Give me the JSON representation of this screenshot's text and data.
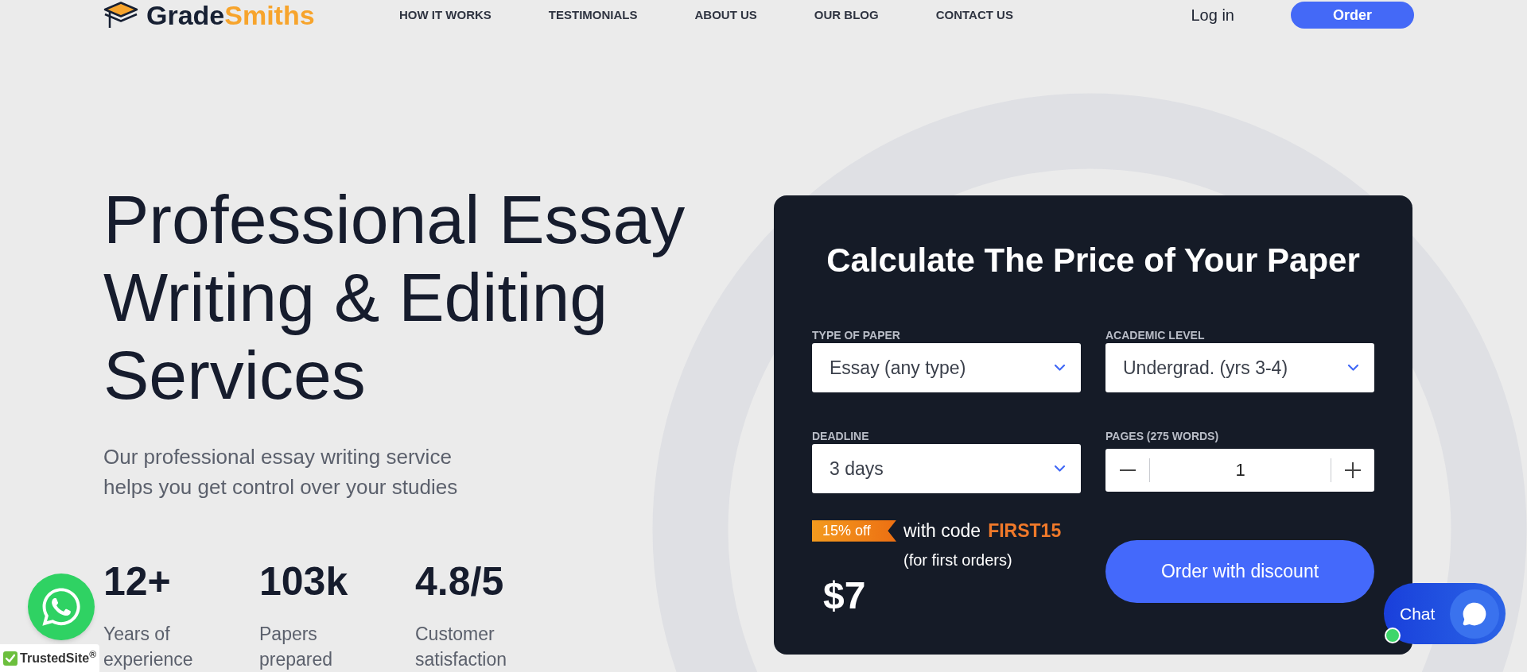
{
  "logo": {
    "word_parts": [
      "Grade",
      "Smiths"
    ]
  },
  "nav": {
    "links": [
      "HOW IT WORKS",
      "TESTIMONIALS",
      "ABOUT US",
      "OUR BLOG",
      "CONTACT US"
    ],
    "login": "Log in",
    "order_button": "Order"
  },
  "hero": {
    "heading_lines": [
      "Professional Essay",
      "Writing & Editing",
      "Services"
    ],
    "subtitle_lines": [
      "Our professional essay writing service",
      "helps you get control over your studies"
    ],
    "stats": [
      {
        "value": "12+",
        "label_lines": [
          "Years of",
          "experience"
        ]
      },
      {
        "value": "103k",
        "label_lines": [
          "Papers",
          "prepared"
        ]
      },
      {
        "value": "4.8/5",
        "label_lines": [
          "Customer",
          "satisfaction"
        ]
      }
    ]
  },
  "calculator": {
    "title": "Calculate The Price of Your Paper",
    "fields": [
      {
        "kind": "select",
        "label": "TYPE OF PAPER",
        "value": "Essay (any type)"
      },
      {
        "kind": "select",
        "label": "ACADEMIC LEVEL",
        "value": "Undergrad. (yrs 3-4)"
      },
      {
        "kind": "select",
        "label": "DEADLINE",
        "value": "3 days"
      },
      {
        "kind": "stepper",
        "label": "PAGES (275 WORDS)",
        "value": "1"
      }
    ],
    "promo": {
      "badge": "15% off",
      "text": "with code",
      "code": "FIRST15",
      "note": "(for first orders)"
    },
    "price": "$7",
    "order_button": "Order with discount"
  },
  "chat_widget": {
    "label": "Chat",
    "online": true
  },
  "trust_badge": {
    "text": "TrustedSite$^{®}$"
  }
}
